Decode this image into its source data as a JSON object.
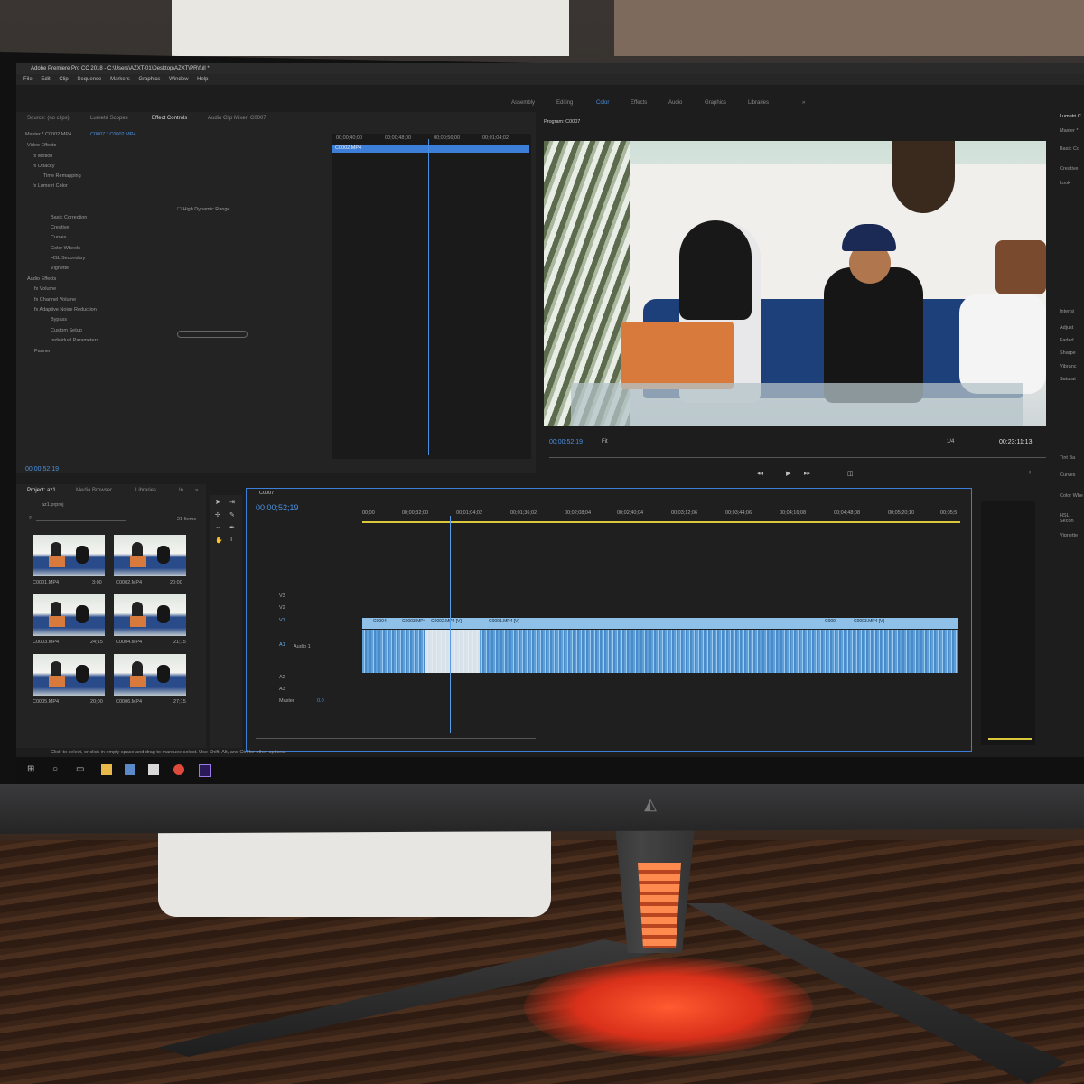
{
  "window": {
    "title": "Adobe Premiere Pro CC 2018 - C:\\Users\\AZXT-01\\Desktop\\AZXT\\PR\\full *"
  },
  "menu": [
    "File",
    "Edit",
    "Clip",
    "Sequence",
    "Markers",
    "Graphics",
    "Window",
    "Help"
  ],
  "workspaces": [
    "Assembly",
    "Editing",
    "Color",
    "Effects",
    "Audio",
    "Graphics",
    "Libraries",
    "»"
  ],
  "active_workspace": "Color",
  "source_panel": {
    "tabs": [
      "Source: (no clips)",
      "Lumetri Scopes",
      "Effect Controls",
      "Audio Clip Mixer: C0007"
    ],
    "active_tab": "Effect Controls",
    "master": "Master * C0002.MP4",
    "clip": "C0007 * C0002.MP4",
    "effects": [
      "Video Effects",
      "fx  Motion",
      "fx  Opacity",
      "Time Remapping",
      "fx  Lumetri Color",
      "Basic Correction",
      "Creative",
      "Curves",
      "Color Wheels",
      "HSL Secondary",
      "Vignette",
      "Audio Effects",
      "fx  Volume",
      "fx  Channel Volume",
      "fx  Adaptive Noise Reduction",
      "Bypass",
      "Custom Setup",
      "Individual Parameters",
      "Panner"
    ],
    "hdr_label": "High Dynamic Range",
    "mini_ruler": [
      "00;00;40;00",
      "00;00;48;00",
      "00;00;56;00",
      "00;01;04;02"
    ],
    "mini_clip": "C0002.MP4",
    "timecode": "00;00;52;19"
  },
  "program": {
    "title": "Program: C0007",
    "timecode": "00;00;52;19",
    "fit": "Fit",
    "resolution": "1/4",
    "duration": "00;23;11;13"
  },
  "project": {
    "tabs": [
      "Project: az1",
      "Media Browser",
      "Libraries",
      "In",
      "»"
    ],
    "file": "az1.prproj",
    "items_count": "21 Items",
    "clips": [
      {
        "name": "C0001.MP4",
        "dur": "3;00"
      },
      {
        "name": "C0002.MP4",
        "dur": "20;00"
      },
      {
        "name": "C0003.MP4",
        "dur": "24;15"
      },
      {
        "name": "C0004.MP4",
        "dur": "21;15"
      },
      {
        "name": "C0005.MP4",
        "dur": "20;00"
      },
      {
        "name": "C0006.MP4",
        "dur": "27;15"
      }
    ]
  },
  "timeline": {
    "sequence": "C0007",
    "timecode": "00;00;52;19",
    "ruler": [
      "00;00",
      "00;00;32;00",
      "00;01;04;02",
      "00;01;36;02",
      "00;02;08;04",
      "00;02;40;04",
      "00;03;12;06",
      "00;03;44;06",
      "00;04;16;08",
      "00;04;48;08",
      "00;05;20;10",
      "00;05;5"
    ],
    "tracks": [
      "V3",
      "V2",
      "V1",
      "A1",
      "A2",
      "A3",
      "Master"
    ],
    "audio_label": "Audio 1",
    "master_value": "0.0",
    "clips": [
      "C0004",
      "C0003.MP4",
      "C0002.MP4 [V]",
      "C0001.MP4 [V]",
      "C000",
      "C0003.MP4 [V]"
    ]
  },
  "right_panel": [
    "Lumetri C",
    "Master *",
    "Basic Co",
    "Creative",
    "Look",
    "Intensi",
    "Adjust",
    "Faded",
    "Sharpe",
    "Vibranc",
    "Saturat",
    "Tint Ba",
    "Curves",
    "Color Whe",
    "HSL Secon",
    "Vignette"
  ],
  "status": "Click to select, or click in empty space and drag to marquee select. Use Shift, Alt, and Ctrl for other options.",
  "colors": {
    "accent": "#4a8fe0",
    "selection": "#3d7ed8",
    "audio": "#5fa0d8"
  }
}
